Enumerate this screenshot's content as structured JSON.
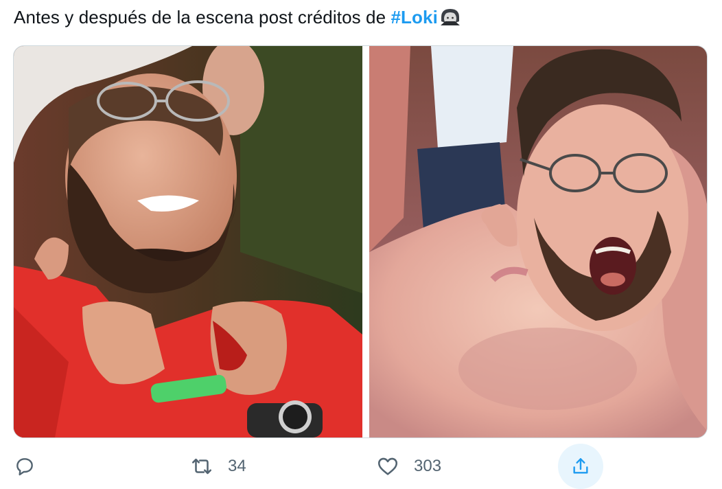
{
  "tweet": {
    "text_prefix": "Antes y después de la escena post créditos de ",
    "hashtag": "#Loki",
    "emoji": "vampire-emoji"
  },
  "media": {
    "left_image": "crying-bearded-fan-red-shirt",
    "right_image": "shirtless-bearded-fan-screaming"
  },
  "actions": {
    "reply": {
      "icon": "reply-icon",
      "count": ""
    },
    "retweet": {
      "icon": "retweet-icon",
      "count": "34"
    },
    "like": {
      "icon": "heart-icon",
      "count": "303"
    },
    "share": {
      "icon": "share-icon"
    }
  },
  "colors": {
    "hashtag": "#1d9bf0",
    "action_gray": "#536471",
    "share_bg": "#e8f5fd",
    "border": "#cfd9de"
  }
}
